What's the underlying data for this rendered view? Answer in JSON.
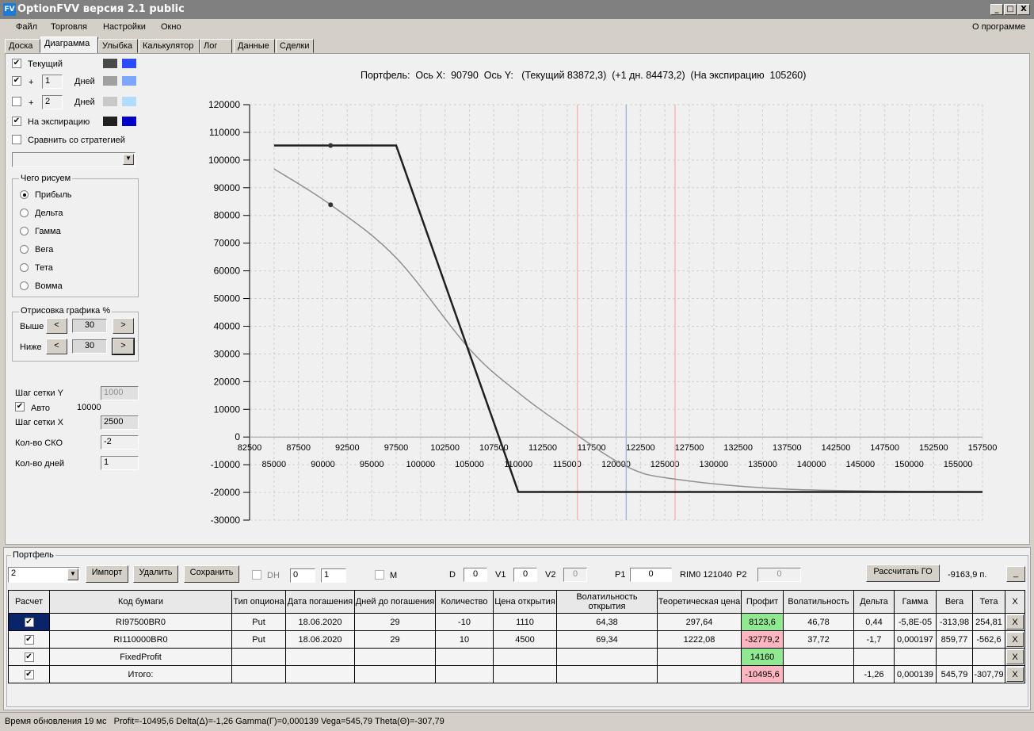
{
  "window": {
    "title": "OptionFVV версия 2.1 public",
    "min": "_",
    "max": "□",
    "close": "X"
  },
  "menu": [
    "Файл",
    "Торговля",
    "Настройки",
    "Окно"
  ],
  "about": "О программе",
  "tabs": [
    "Доска",
    "Диаграмма",
    "Улыбка",
    "Калькулятор",
    "Лог",
    "Данные",
    "Сделки"
  ],
  "active_tab": "Диаграмма",
  "left": {
    "current": {
      "label": "Текущий",
      "checked": true,
      "colors": [
        "#4a4a4a",
        "#2a4dff"
      ]
    },
    "plus1": {
      "plus": "+",
      "value": "1",
      "unit": "Дней",
      "checked": true,
      "colors": [
        "#a0a0a0",
        "#7fa6ff"
      ]
    },
    "plus2": {
      "plus": "+",
      "value": "2",
      "unit": "Дней",
      "checked": false,
      "colors": [
        "#c8c8c8",
        "#b0dcff"
      ]
    },
    "expiry": {
      "label": "На экспирацию",
      "checked": true,
      "colors": [
        "#202020",
        "#0000c8"
      ]
    },
    "compare": {
      "label": "Сравнить со стратегией",
      "checked": false
    },
    "what_group": "Чего рисуем",
    "what": [
      "Прибыль",
      "Дельта",
      "Гамма",
      "Вега",
      "Тета",
      "Вомма"
    ],
    "what_selected": 0,
    "draw_group": "Отрисовка графика %",
    "above": {
      "label": "Выше",
      "value": "30"
    },
    "below": {
      "label": "Ниже",
      "value": "30"
    },
    "prev": "<",
    "next": ">",
    "grid_y": {
      "label": "Шаг сетки Y",
      "value": "1000"
    },
    "auto": {
      "label": "Авто",
      "checked": true,
      "value": "10000"
    },
    "grid_x": {
      "label": "Шаг сетки X",
      "value": "2500"
    },
    "sko": {
      "label": "Кол-во СКО",
      "value": "-2"
    },
    "days": {
      "label": "Кол-во дней",
      "value": "1"
    }
  },
  "chart_data": {
    "type": "line",
    "title": "Портфель:  Ось X:  90790  Ось Y:   (Текущий 83872,3)  (+1 дн. 84473,2)  (На экспирацию  105260)",
    "xlim": [
      82500,
      157500
    ],
    "ylim": [
      -30000,
      120000
    ],
    "grid": true,
    "x_ticks_top": [
      82500,
      87500,
      92500,
      97500,
      102500,
      107500,
      112500,
      117500,
      122500,
      127500,
      132500,
      137500,
      142500,
      147500,
      152500,
      157500
    ],
    "x_ticks_bottom": [
      85000,
      90000,
      95000,
      100000,
      105000,
      110000,
      115000,
      120000,
      125000,
      130000,
      135000,
      140000,
      145000,
      150000,
      155000
    ],
    "y_ticks": [
      120000,
      110000,
      100000,
      90000,
      80000,
      70000,
      60000,
      50000,
      40000,
      30000,
      20000,
      10000,
      0,
      -10000,
      -20000,
      -30000
    ],
    "series": [
      {
        "id": "expiry",
        "color": "#202020",
        "x": [
          85000,
          97500,
          110000,
          157500
        ],
        "y": [
          105260,
          105260,
          -19840,
          -19840
        ]
      },
      {
        "id": "current",
        "color": "#909090",
        "x": [
          85000,
          90790,
          97500,
          105000,
          110000,
          115000,
          121040,
          126000,
          138000,
          157500
        ],
        "y": [
          96800,
          83872,
          64700,
          31800,
          16000,
          3150,
          -10600,
          -15200,
          -18900,
          -19840
        ]
      }
    ],
    "markers": [
      {
        "x": 90790,
        "y": 105260
      },
      {
        "x": 90790,
        "y": 83872
      }
    ],
    "vlines": [
      {
        "x": 121040,
        "color": "#a8b8d8"
      },
      {
        "x": 116040,
        "color": "#f4b8b8"
      },
      {
        "x": 126040,
        "color": "#f4b8b8"
      }
    ]
  },
  "portfolio": {
    "group": "Портфель",
    "select": "2",
    "import": "Импорт",
    "delete": "Удалить",
    "save": "Сохранить",
    "dh": "DH",
    "spin1": "0",
    "spin2": "1",
    "m": "M",
    "d_label": "D",
    "d": "0",
    "v1_label": "V1",
    "v1": "0",
    "v2_label": "V2",
    "v2": "0",
    "p1_label": "P1",
    "p1": "0",
    "rim": "RIM0 121040",
    "p2_label": "P2",
    "p2": "0",
    "calc": "Рассчитать ГО",
    "go": "-9163,9 п.",
    "collapse": "_",
    "columns": [
      "Расчет",
      "Код бумаги",
      "Тип опциона",
      "Дата погашения",
      "Дней до погашения",
      "Количество",
      "Цена открытия",
      "Волатильность открытия",
      "Теоретическая цена",
      "Профит",
      "Волатильность",
      "Дельта",
      "Гамма",
      "Вега",
      "Тета",
      "X"
    ],
    "rows": [
      {
        "checked": true,
        "cells": [
          "RI97500BR0",
          "Put",
          "18.06.2020",
          "29",
          "-10",
          "1110",
          "64,38",
          "297,64",
          "8123,6",
          "46,78",
          "0,44",
          "-5,8E-05",
          "-313,98",
          "254,81",
          "X"
        ],
        "profit_color": "#90e890"
      },
      {
        "checked": true,
        "cells": [
          "RI110000BR0",
          "Put",
          "18.06.2020",
          "29",
          "10",
          "4500",
          "69,34",
          "1222,08",
          "-32779,2",
          "37,72",
          "-1,7",
          "0,000197",
          "859,77",
          "-562,6",
          "X"
        ],
        "profit_color": "#ffb6c1"
      },
      {
        "checked": true,
        "cells": [
          "FixedProfit",
          "",
          "",
          "",
          "",
          "",
          "",
          "",
          "14160",
          "",
          "",
          "",
          "",
          "",
          "X"
        ],
        "profit_color": "#90e890"
      },
      {
        "checked": true,
        "cells": [
          "Итого:",
          "",
          "",
          "",
          "",
          "",
          "",
          "",
          "-10495,6",
          "",
          "-1,26",
          "0,000139",
          "545,79",
          "-307,79",
          "X"
        ],
        "profit_color": "#ffb6c1"
      }
    ]
  },
  "status": "Время обновления 19 мс   Profit=-10495,6 Delta(Δ)=-1,26 Gamma(Γ)=0,000139 Vega=545,79 Theta(Θ)=-307,79"
}
